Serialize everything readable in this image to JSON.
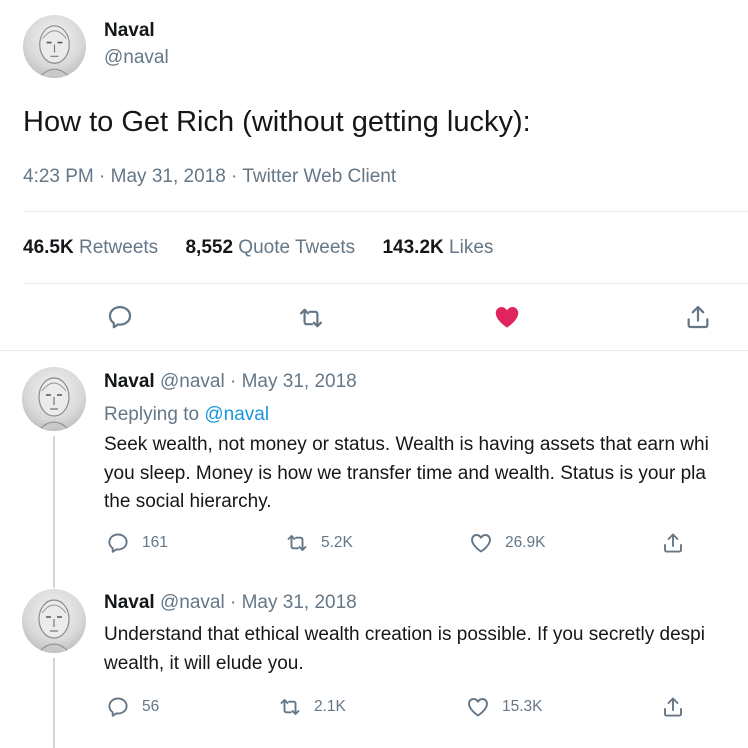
{
  "main_tweet": {
    "author_name": "Naval",
    "author_handle": "@naval",
    "text": "How to Get Rich (without getting lucky):",
    "meta": "4:23 PM · May 31, 2018 · Twitter Web Client",
    "stats": {
      "retweets_count": "46.5K",
      "retweets_label": "Retweets",
      "quotes_count": "8,552",
      "quotes_label": "Quote Tweets",
      "likes_count": "143.2K",
      "likes_label": "Likes"
    },
    "liked": true
  },
  "replies": [
    {
      "author_name": "Naval",
      "handle_date": "@naval · May 31, 2018",
      "replying_prefix": "Replying to",
      "replying_handle": "@naval",
      "text_lines": [
        "Seek wealth, not money or status. Wealth is having assets that earn whi",
        "you sleep. Money is how we transfer time and wealth. Status is your pla",
        "the social hierarchy."
      ],
      "reply_count": "161",
      "retweet_count": "5.2K",
      "like_count": "26.9K"
    },
    {
      "author_name": "Naval",
      "handle_date": "@naval · May 31, 2018",
      "text_lines": [
        "Understand that ethical wealth creation is possible. If you secretly despi",
        "wealth, it will elude you."
      ],
      "reply_count": "56",
      "retweet_count": "2.1K",
      "like_count": "15.3K"
    }
  ],
  "icons": {
    "reply": "reply-icon",
    "retweet": "retweet-icon",
    "like": "heart-icon",
    "share": "share-icon",
    "avatar": "avatar"
  },
  "colors": {
    "like_active": "#e0245e",
    "link": "#1b95e0",
    "secondary_text": "#657786",
    "divider": "#e6ecf0"
  }
}
